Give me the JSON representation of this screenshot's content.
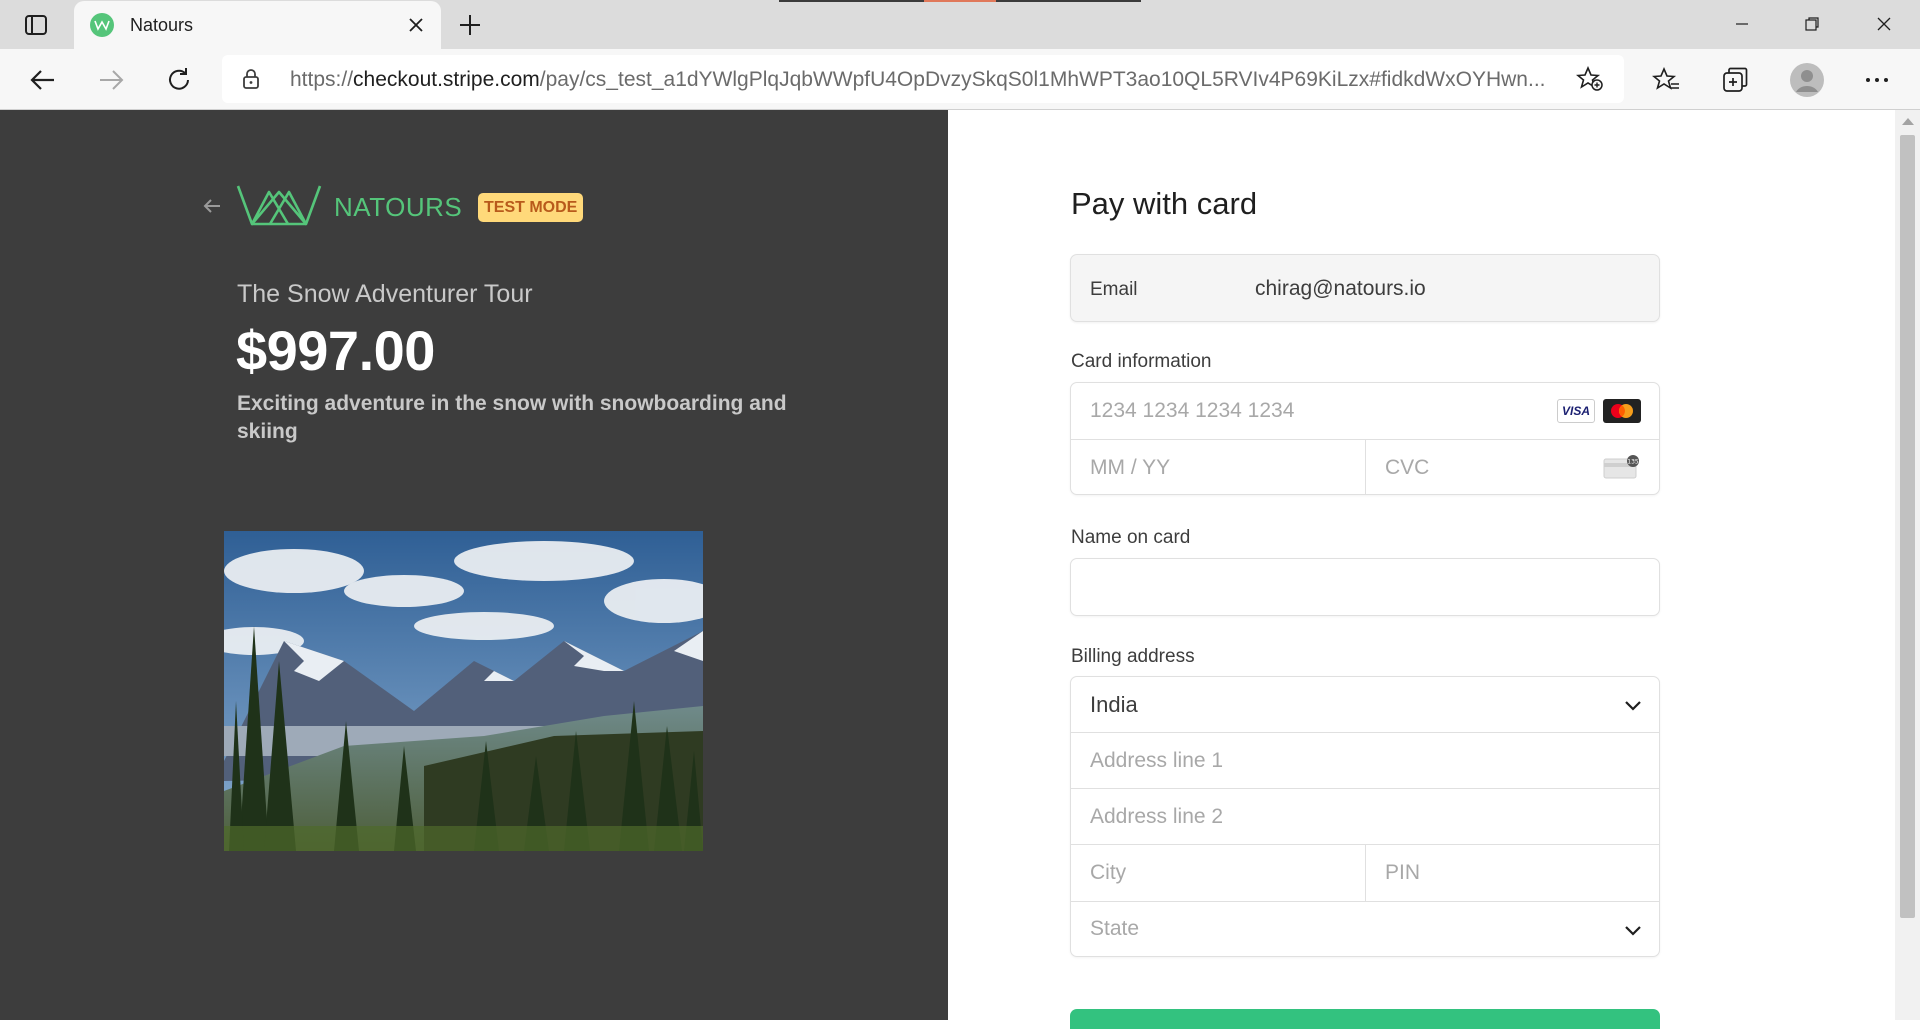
{
  "browser": {
    "tab_title": "Natours",
    "url_prefix": "https://",
    "url_domain": "checkout.stripe.com",
    "url_path": "/pay/cs_test_a1dYWlgPlqJqbWWpfU4OpDvzySkqS0l1MhWPT3ao10QL5RVIv4P69KiLzx#fidkdWxOYHwn...",
    "icons": [
      "tab-actions-icon",
      "favicon-icon",
      "close-icon",
      "plus-icon",
      "minimize-icon",
      "restore-icon",
      "close-window-icon",
      "back-icon",
      "forward-icon",
      "refresh-icon",
      "lock-icon",
      "add-favorite-icon",
      "favorites-icon",
      "collections-icon",
      "profile-icon",
      "more-icon"
    ]
  },
  "product": {
    "brand": "NATOURS",
    "badge": "TEST MODE",
    "name": "The Snow Adventurer Tour",
    "price": "$997.00",
    "description": "Exciting adventure in the snow with snowboarding and skiing"
  },
  "form": {
    "title": "Pay with card",
    "email_label": "Email",
    "email_value": "chirag@natours.io",
    "card_label": "Card information",
    "card_number_placeholder": "1234 1234 1234 1234",
    "expiry_placeholder": "MM / YY",
    "cvc_placeholder": "CVC",
    "visa_label": "VISA",
    "name_label": "Name on card",
    "name_value": "",
    "billing_label": "Billing address",
    "country": "India",
    "address1_placeholder": "Address line 1",
    "address2_placeholder": "Address line 2",
    "city_placeholder": "City",
    "pin_placeholder": "PIN",
    "state_placeholder": "State"
  },
  "colors": {
    "brand_green": "#55c57a",
    "left_background": "#3d3d3d",
    "badge_background": "#ffd97a",
    "pay_button": "#33c27f"
  }
}
